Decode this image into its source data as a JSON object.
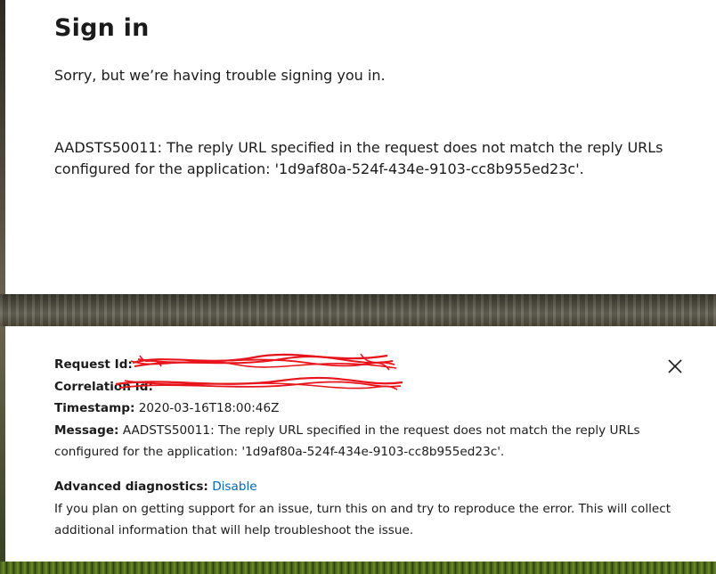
{
  "signin": {
    "title": "Sign in",
    "subtitle": "Sorry, but we’re having trouble signing you in.",
    "error_message": "AADSTS50011: The reply URL specified in the request does not match the reply URLs configured for the application: '1d9af80a-524f-434e-9103-cc8b955ed23c'."
  },
  "diagnostics": {
    "request_id_label": "Request Id:",
    "correlation_id_label": "Correlation Id:",
    "timestamp_label": "Timestamp:",
    "timestamp_value": "2020-03-16T18:00:46Z",
    "message_label": "Message:",
    "message_value": "AADSTS50011: The reply URL specified in the request does not match the reply URLs configured for the application: '1d9af80a-524f-434e-9103-cc8b955ed23c'.",
    "advanced_label": "Advanced diagnostics:",
    "advanced_link": "Disable",
    "advanced_help": "If you plan on getting support for an issue, turn this on and try to reproduce the error. This will collect additional information that will help troubleshoot the issue.",
    "close_icon": "close-icon",
    "redaction_color": "#e8141c"
  },
  "colors": {
    "text": "#1b1b1b",
    "link": "#0067b8",
    "card": "#ffffff"
  }
}
